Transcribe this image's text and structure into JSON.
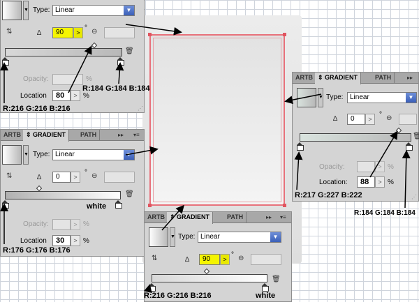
{
  "panel_a": {
    "type_label": "Type:",
    "type_value": "Linear",
    "angle_value": "90",
    "opacity_label": "Opacity:",
    "location_label": "Location",
    "location_value": "80",
    "pct": "%",
    "deg": "°"
  },
  "panel_b": {
    "tabs": [
      "ARTB",
      "GRADIENT",
      "PATH"
    ],
    "type_label": "Type:",
    "type_value": "Linear",
    "angle_value": "0",
    "opacity_label": "Opacity:",
    "location_label": "Location",
    "location_value": "30",
    "pct": "%",
    "deg": "°"
  },
  "panel_c": {
    "tabs": [
      "ARTB",
      "GRADIENT",
      "PATH"
    ],
    "type_label": "Type:",
    "type_value": "Linear",
    "angle_value": "0",
    "opacity_label": "Opacity:",
    "location_label": "Location:",
    "location_value": "88",
    "pct": "%",
    "deg": "°"
  },
  "panel_d": {
    "tabs": [
      "ARTB",
      "GRADIENT",
      "PATH"
    ],
    "type_label": "Type:",
    "type_value": "Linear",
    "angle_value": "90",
    "deg": "°"
  },
  "annotations": {
    "a_left": "R:216 G:216 B:216",
    "a_right": "R:184 G:184 B:184",
    "b_left": "R:176 G:176 B:176",
    "b_right": "white",
    "c_left": "R:217 G:227 B:222",
    "c_right": "R:184 G:184 B:184",
    "d_left": "R:216 G:216 B:216",
    "d_right": "white"
  },
  "icons": {
    "swap": "swap-stops-icon",
    "angle": "angle-icon",
    "aspect": "aspect-ratio-icon",
    "trash": "trash-icon",
    "menu": "panel-menu-icon"
  }
}
